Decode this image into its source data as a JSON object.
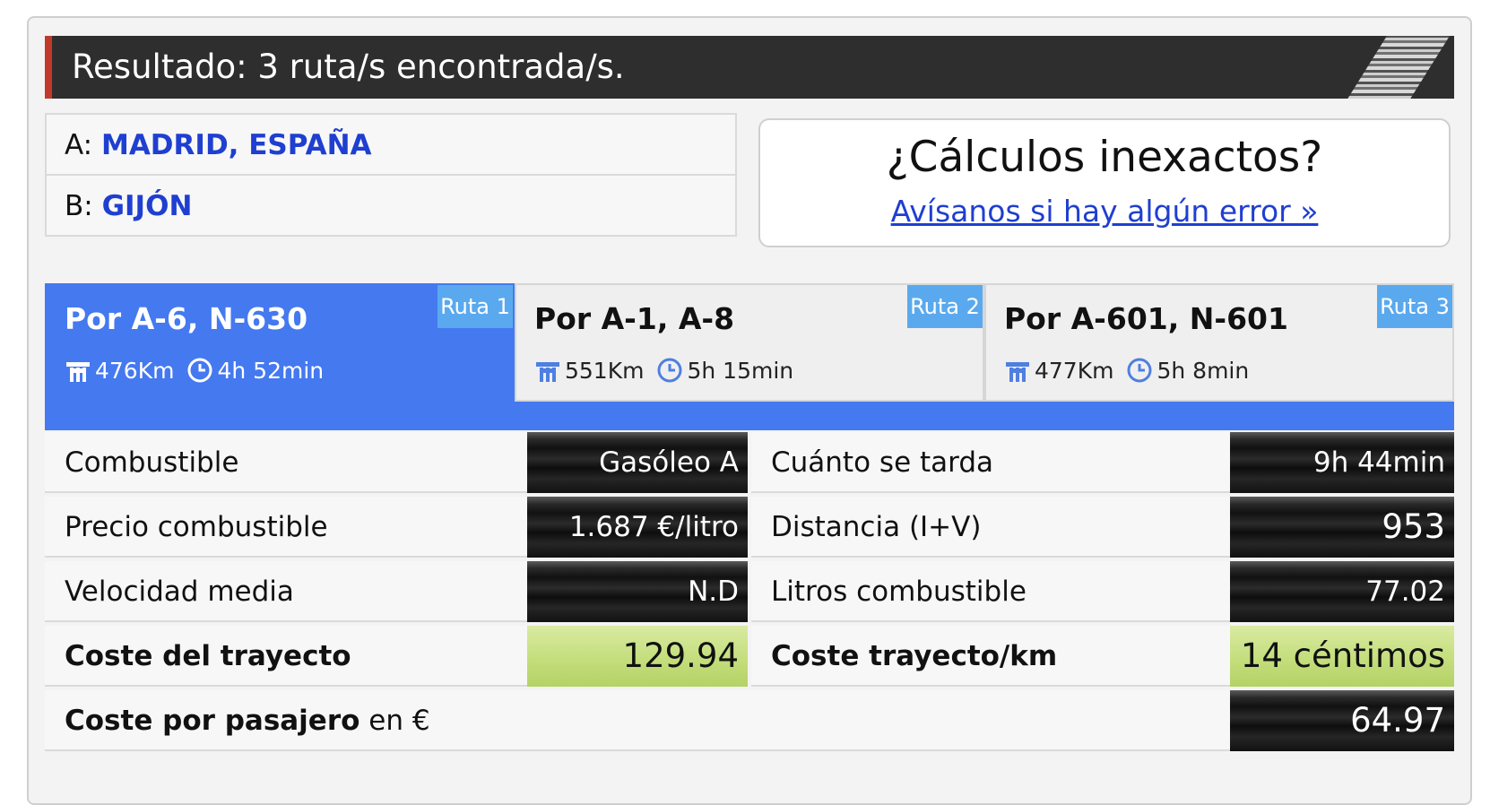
{
  "header": {
    "title": "Resultado: 3 ruta/s encontrada/s."
  },
  "addresses": {
    "a_prefix": "A:",
    "a_value": "MADRID, ESPAÑA",
    "b_prefix": "B:",
    "b_value": "GIJÓN"
  },
  "feedback": {
    "title": "¿Cálculos inexactos?",
    "link": "Avísanos si hay algún error »"
  },
  "routes": [
    {
      "name": "Por A-6, N-630",
      "badge": "Ruta 1",
      "distance": "476Km",
      "time": "4h 52min",
      "active": true
    },
    {
      "name": "Por A-1, A-8",
      "badge": "Ruta 2",
      "distance": "551Km",
      "time": "5h 15min",
      "active": false
    },
    {
      "name": "Por A-601, N-601",
      "badge": "Ruta 3",
      "distance": "477Km",
      "time": "5h 8min",
      "active": false
    }
  ],
  "details": {
    "fuel_label": "Combustible",
    "fuel_value": "Gasóleo A",
    "price_label": "Precio combustible",
    "price_value": "1.687 €/litro",
    "speed_label": "Velocidad media",
    "speed_value": "N.D",
    "cost_label": "Coste del trayecto",
    "cost_value": "129.94",
    "duration_label": "Cuánto se tarda",
    "duration_value": "9h 44min",
    "distance_label": "Distancia (I+V)",
    "distance_value": "953",
    "liters_label": "Litros combustible",
    "liters_value": "77.02",
    "cost_km_label": "Coste trayecto/km",
    "cost_km_value": "14 céntimos",
    "passenger_label_bold": "Coste por pasajero",
    "passenger_label_suffix": " en €",
    "passenger_value": "64.97"
  },
  "colors": {
    "accent_blue": "#4479f0",
    "badge_blue": "#5aa9ee",
    "header_red": "#c0392b",
    "link_blue": "#1f3fd1",
    "highlight_green": "#c4de7c"
  }
}
